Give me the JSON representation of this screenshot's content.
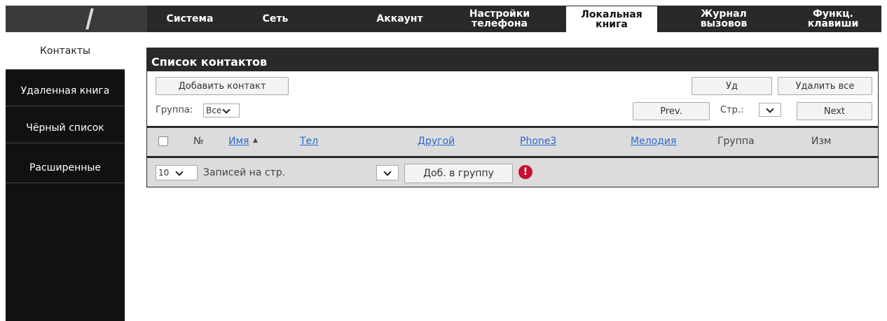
{
  "nav": {
    "tabs": [
      {
        "label": "Система"
      },
      {
        "label": "Сеть"
      },
      {
        "label": "Аккаунт"
      },
      {
        "label": "Настройки\nтелефона"
      },
      {
        "label": "Локальная\nкнига"
      },
      {
        "label": "Журнал\nвызовов"
      },
      {
        "label": "Функц.\nклавиши"
      }
    ],
    "active_tab": "Локальная книга"
  },
  "sidebar": {
    "items": [
      {
        "label": "Контакты"
      },
      {
        "label": "Удаленная книга"
      },
      {
        "label": "Чёрный список"
      },
      {
        "label": "Расширенные"
      }
    ],
    "active_item": "Контакты"
  },
  "panel": {
    "title": "Список контактов",
    "add_contact_label": "Добавить контакт",
    "delete_label": "Уд",
    "delete_all_label": "Удалить все",
    "group_label": "Группа:",
    "group_value": "Все",
    "prev_label": "Prev.",
    "page_label": "Стр.:",
    "next_label": "Next"
  },
  "table": {
    "columns": {
      "number": "№",
      "name": "Имя",
      "phone": "Тел",
      "other": "Другой",
      "phone3": "Phone3",
      "ringtone": "Мелодия",
      "group": "Группа",
      "edit": "Изм"
    }
  },
  "footer": {
    "per_page_value": "10",
    "per_page_label": "Записей на стр.",
    "add_to_group_label": "Доб. в группу",
    "alert_glyph": "!"
  },
  "colors": {
    "nav_bg": "#292929",
    "link": "#2a6ad1",
    "alert": "#c8102e",
    "table_bg": "#dcdcdc"
  }
}
